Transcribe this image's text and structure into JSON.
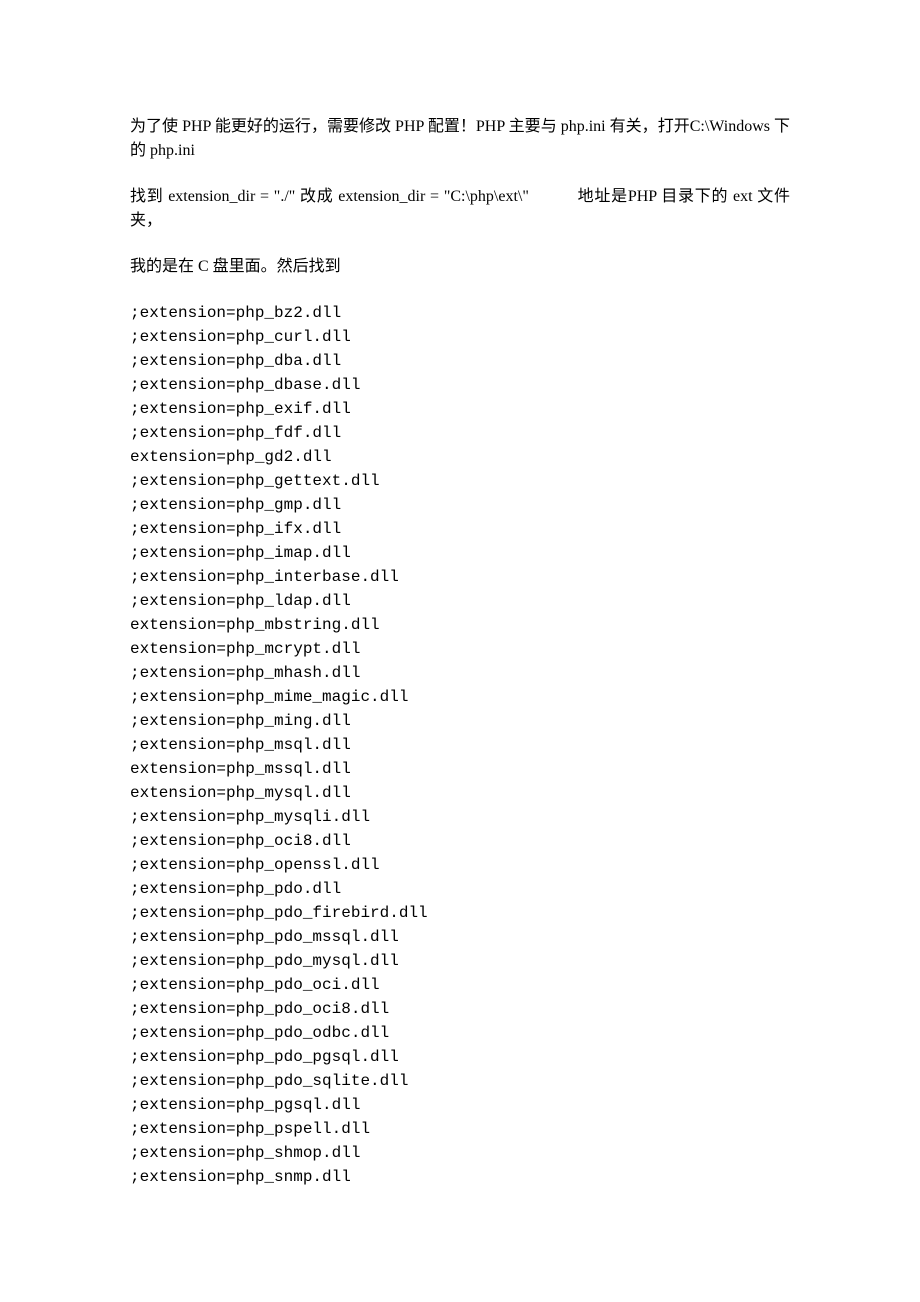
{
  "para1": {
    "t1": "为了使 PHP 能更好的运行，需要修改 PHP 配置！PHP 主要与 php.ini 有关，打开C:\\Windows 下的 php.ini"
  },
  "para2": {
    "t1": "找到 extension_dir = \"./\" 改成 extension_dir = \"C:\\php\\ext\\\"",
    "t2": "地址是PHP 目录下的 ext 文件夹，"
  },
  "para3": {
    "t1": "我的是在 C 盘里面。然后找到"
  },
  "code": {
    "lines": [
      ";extension=php_bz2.dll",
      ";extension=php_curl.dll",
      ";extension=php_dba.dll",
      ";extension=php_dbase.dll",
      ";extension=php_exif.dll",
      ";extension=php_fdf.dll",
      "extension=php_gd2.dll",
      ";extension=php_gettext.dll",
      ";extension=php_gmp.dll",
      ";extension=php_ifx.dll",
      ";extension=php_imap.dll",
      ";extension=php_interbase.dll",
      ";extension=php_ldap.dll",
      "extension=php_mbstring.dll",
      "extension=php_mcrypt.dll",
      ";extension=php_mhash.dll",
      ";extension=php_mime_magic.dll",
      ";extension=php_ming.dll",
      ";extension=php_msql.dll",
      "extension=php_mssql.dll",
      "extension=php_mysql.dll",
      ";extension=php_mysqli.dll",
      ";extension=php_oci8.dll",
      ";extension=php_openssl.dll",
      ";extension=php_pdo.dll",
      ";extension=php_pdo_firebird.dll",
      ";extension=php_pdo_mssql.dll",
      ";extension=php_pdo_mysql.dll",
      ";extension=php_pdo_oci.dll",
      ";extension=php_pdo_oci8.dll",
      ";extension=php_pdo_odbc.dll",
      ";extension=php_pdo_pgsql.dll",
      ";extension=php_pdo_sqlite.dll",
      ";extension=php_pgsql.dll",
      ";extension=php_pspell.dll",
      ";extension=php_shmop.dll",
      ";extension=php_snmp.dll"
    ]
  }
}
